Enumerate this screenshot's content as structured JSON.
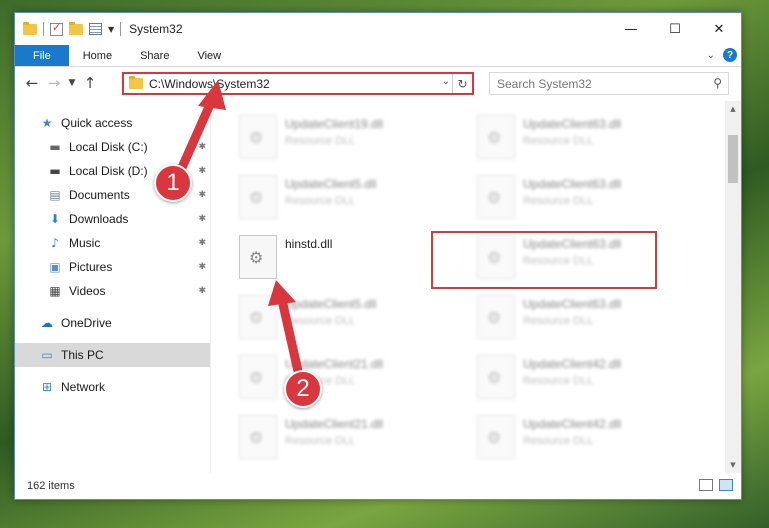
{
  "window": {
    "title": "System32",
    "controls": {
      "minimize": "—",
      "maximize": "☐",
      "close": "✕"
    }
  },
  "ribbon": {
    "tabs": [
      "File",
      "Home",
      "Share",
      "View"
    ],
    "collapse_icon": "chevron-down-icon",
    "help_label": "?"
  },
  "address_bar": {
    "path": "C:\\Windows\\System32",
    "refresh_icon": "↻"
  },
  "search": {
    "placeholder": "Search System32",
    "icon": "⚲"
  },
  "sidebar": {
    "items": [
      {
        "label": "Quick access",
        "icon": "star-icon",
        "glyph": "★",
        "color": "#3a86d4"
      },
      {
        "label": "Local Disk (C:)",
        "icon": "drive-icon",
        "glyph": "▬",
        "color": "#666"
      },
      {
        "label": "Local Disk (D:)",
        "icon": "drive-icon",
        "glyph": "▬",
        "color": "#444"
      },
      {
        "label": "Documents",
        "icon": "documents-icon",
        "glyph": "▤",
        "color": "#6a7f96"
      },
      {
        "label": "Downloads",
        "icon": "download-icon",
        "glyph": "⬇",
        "color": "#2f7fd0"
      },
      {
        "label": "Music",
        "icon": "music-icon",
        "glyph": "♪",
        "color": "#2f7fd0"
      },
      {
        "label": "Pictures",
        "icon": "pictures-icon",
        "glyph": "▣",
        "color": "#5b8bd0"
      },
      {
        "label": "Videos",
        "icon": "videos-icon",
        "glyph": "▦",
        "color": "#444"
      },
      {
        "label": "OneDrive",
        "icon": "cloud-icon",
        "glyph": "☁",
        "color": "#1e6fc8"
      },
      {
        "label": "This PC",
        "icon": "computer-icon",
        "glyph": "▭",
        "color": "#3a86d4"
      },
      {
        "label": "Network",
        "icon": "network-icon",
        "glyph": "⊞",
        "color": "#3a86d4"
      }
    ],
    "pin_glyph": "📌"
  },
  "files": [
    {
      "name": "UpdateClient19.dll",
      "type": "Resource DLL"
    },
    {
      "name": "UpdateClient63.dll",
      "type": "Resource DLL"
    },
    {
      "name": "UpdateClient5.dll",
      "type": "Resource DLL"
    },
    {
      "name": "UpdateClient63.dll",
      "type": "Resource DLL"
    },
    {
      "name": "hinstd.dll",
      "type": ""
    },
    {
      "name": "UpdateClient63.dll",
      "type": "Resource DLL"
    },
    {
      "name": "UpdateClient5.dll",
      "type": "Resource DLL"
    },
    {
      "name": "UpdateClient63.dll",
      "type": "Resource DLL"
    },
    {
      "name": "UpdateClient21.dll",
      "type": "Resource DLL"
    },
    {
      "name": "UpdateClient42.dll",
      "type": "Resource DLL"
    },
    {
      "name": "UpdateClient21.dll",
      "type": "Resource DLL"
    },
    {
      "name": "UpdateClient42.dll",
      "type": "Resource DLL"
    }
  ],
  "status": {
    "item_count": "162 items"
  },
  "annotations": {
    "step1": "1",
    "step2": "2",
    "highlight_color": "#d9363e"
  }
}
